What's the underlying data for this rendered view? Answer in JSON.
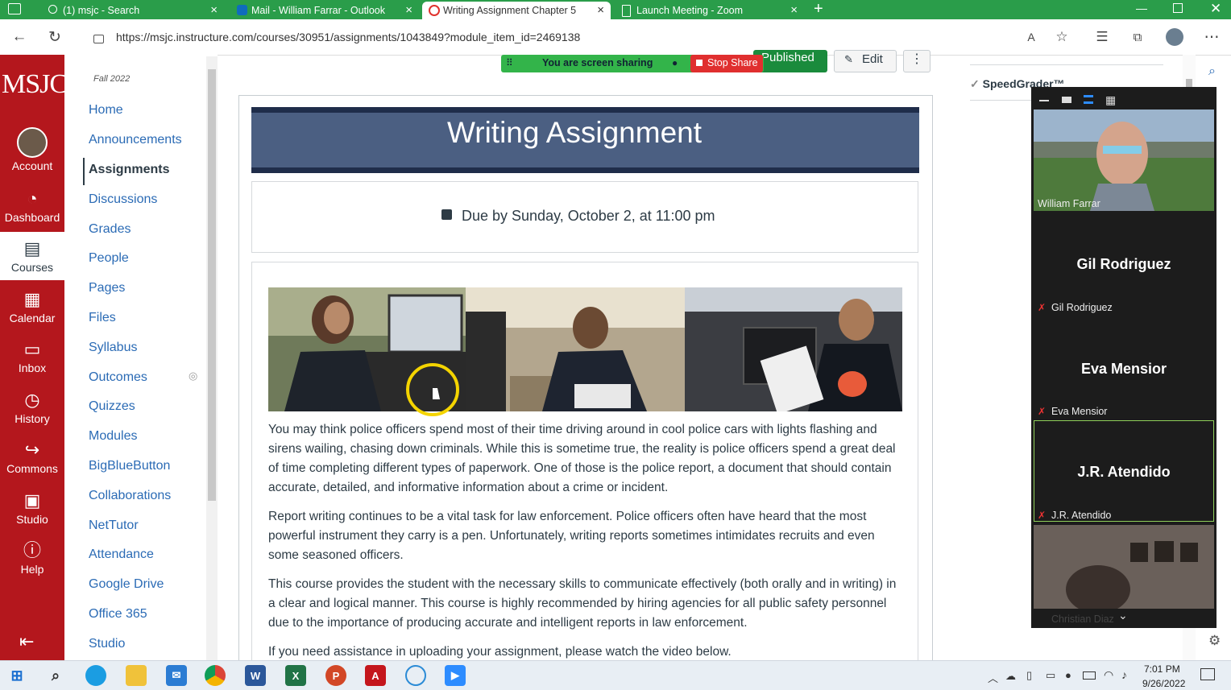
{
  "browser": {
    "tabs": [
      {
        "label": "(1) msjc - Search"
      },
      {
        "label": "Mail - William Farrar - Outlook"
      },
      {
        "label": "Writing Assignment Chapter 5"
      },
      {
        "label": "Launch Meeting - Zoom"
      }
    ],
    "new_tab": "+",
    "url": "https://msjc.instructure.com/courses/30951/assignments/1043849?module_item_id=2469138"
  },
  "global_nav": {
    "logo": "MSJC",
    "items": [
      {
        "label": "Account",
        "icon": "avatar"
      },
      {
        "label": "Dashboard",
        "icon": "dashboard-icon"
      },
      {
        "label": "Courses",
        "icon": "courses-icon"
      },
      {
        "label": "Calendar",
        "icon": "calendar-icon"
      },
      {
        "label": "Inbox",
        "icon": "inbox-icon"
      },
      {
        "label": "History",
        "icon": "clock-icon"
      },
      {
        "label": "Commons",
        "icon": "commons-icon"
      },
      {
        "label": "Studio",
        "icon": "studio-icon"
      },
      {
        "label": "Help",
        "icon": "help-icon"
      }
    ],
    "collapse_icon": "collapse-nav-icon"
  },
  "course_nav": {
    "term": "Fall 2022",
    "items": [
      {
        "label": "Home"
      },
      {
        "label": "Announcements"
      },
      {
        "label": "Assignments"
      },
      {
        "label": "Discussions"
      },
      {
        "label": "Grades"
      },
      {
        "label": "People"
      },
      {
        "label": "Pages"
      },
      {
        "label": "Files"
      },
      {
        "label": "Syllabus"
      },
      {
        "label": "Outcomes"
      },
      {
        "label": "Quizzes"
      },
      {
        "label": "Modules"
      },
      {
        "label": "BigBlueButton"
      },
      {
        "label": "Collaborations"
      },
      {
        "label": "NetTutor"
      },
      {
        "label": "Attendance"
      },
      {
        "label": "Google Drive"
      },
      {
        "label": "Office 365"
      },
      {
        "label": "Studio"
      }
    ]
  },
  "toolbar": {
    "published_label": "Published",
    "edit_label": "Edit",
    "more_label": "⋮"
  },
  "screen_share": {
    "status": "You are screen sharing",
    "stop_label": "Stop Share"
  },
  "speedgrader_label": "SpeedGrader™",
  "assignment": {
    "banner_title": "Writing Assignment",
    "due": "Due by Sunday, October 2, at 11:00 pm",
    "paragraphs": [
      "You may think police officers spend most of their time driving around in cool police cars with lights flashing and sirens wailing, chasing down criminals. While this is sometime true, the reality is police officers spend a great deal of time completing different types of paperwork. One of those is the police report, a document that should contain accurate, detailed, and informative information about a crime or incident.",
      "Report writing continues to be a vital task for law enforcement. Police officers often have heard that the most powerful instrument they carry is a pen. Unfortunately, writing reports sometimes intimidates recruits and even some seasoned officers.",
      "This course provides the student with the necessary skills to communicate effectively (both orally and in writing) in a clear and logical manner. This course is highly recommended by hiring agencies for all public safety personnel due to the importance of producing accurate and intelligent reports in law enforcement.",
      "If you need assistance in uploading your assignment, please watch the video below."
    ]
  },
  "zoom": {
    "participants": [
      {
        "name": "William Farrar",
        "video": true
      },
      {
        "name": "Gil Rodriguez",
        "video": false
      },
      {
        "name": "Eva Mensior",
        "video": false
      },
      {
        "name": "J.R. Atendido",
        "video": false
      },
      {
        "name": "Christian Diaz",
        "video": true
      }
    ]
  },
  "taskbar": {
    "time": "7:01 PM",
    "date": "9/26/2022"
  },
  "colors": {
    "canvas_red": "#b4171d",
    "link_blue": "#2b6bb5",
    "banner_blue": "#4b5f82",
    "published_green": "#1a8b3c",
    "tab_green": "#2a9d4a"
  }
}
